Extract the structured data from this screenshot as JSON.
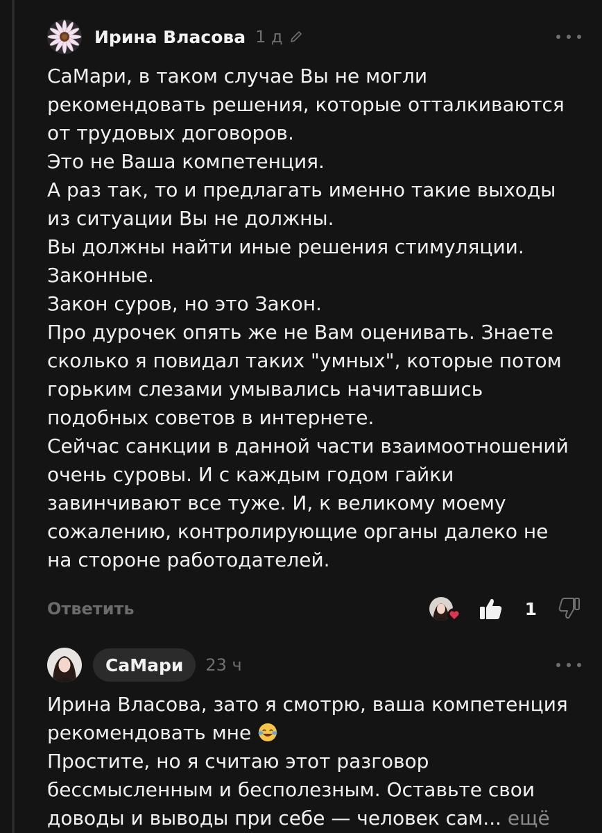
{
  "comments": [
    {
      "author": "Ирина Власова",
      "time": "1 д",
      "icons": {
        "edited": "pencil-icon",
        "more": "more-dots-icon"
      },
      "lines": [
        "СаМари, в таком случае Вы не могли",
        "рекомендовать решения, которые отталкиваются",
        "от трудовых договоров.",
        "Это не Ваша компетенция.",
        "А раз так, то и предлагать именно такие выходы",
        "из ситуации Вы не должны.",
        "Вы должны найти иные решения стимуляции.",
        "Законные.",
        "Закон суров, но это Закон.",
        "Про дурочек опять же не Вам оценивать. Знаете",
        "сколько я повидал таких \"умных\", которые потом",
        "горьким слезами умывались начитавшись",
        "подобных советов в интернете.",
        "Сейчас санкции в данной части взаимоотношений",
        "очень суровы. И с каждым годом гайки",
        "завинчивают все туже. И, к великому моему",
        "сожалению, контролирующие органы далеко не",
        "на стороне работодателей."
      ],
      "actions": {
        "reply": "Ответить",
        "likes": "1",
        "icons": {
          "like": "thumbs-up-icon",
          "dislike": "thumbs-down-icon",
          "reaction": "heart-icon"
        }
      }
    },
    {
      "author": "СаМари",
      "time": "23 ч",
      "icons": {
        "more": "more-dots-icon",
        "emoji": "tears-of-joy-emoji"
      },
      "lines": [
        "Ирина Власова, зато я смотрю, ваша компетенция",
        "рекомендовать мне",
        "Простите, но я считаю этот разговор",
        "бессмысленным и бесполезным. Оставьте свои",
        "доводы и выводы при себе — человек сам..."
      ],
      "more_link": "ещё"
    }
  ],
  "colors": {
    "background": "#141414",
    "text": "#f1f1f1",
    "muted": "#6f6f6f",
    "pill": "#2b2b2b",
    "heart": "#e5334b"
  }
}
